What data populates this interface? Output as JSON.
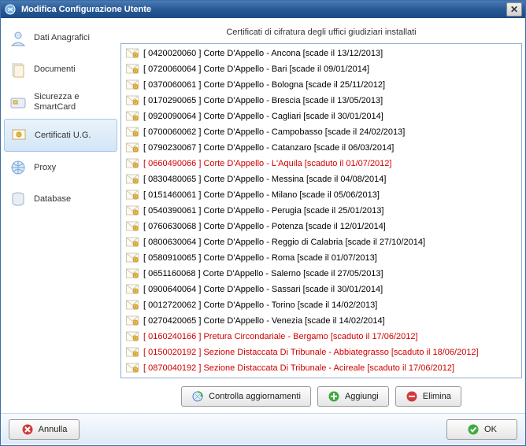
{
  "window": {
    "title": "Modifica Configurazione Utente"
  },
  "sidebar": {
    "items": [
      {
        "label": "Dati Anagrafici"
      },
      {
        "label": "Documenti"
      },
      {
        "label": "Sicurezza e SmartCard"
      },
      {
        "label": "Certificati U.G."
      },
      {
        "label": "Proxy"
      },
      {
        "label": "Database"
      }
    ],
    "selected_index": 3
  },
  "panel": {
    "header": "Certificati di cifratura degli uffici giudiziari installati"
  },
  "certificates": [
    {
      "text": "[ 0420020060 ] Corte D'Appello - Ancona [scade il 13/12/2013]",
      "expired": false
    },
    {
      "text": "[ 0720060064 ] Corte D'Appello - Bari [scade il 09/01/2014]",
      "expired": false
    },
    {
      "text": "[ 0370060061 ] Corte D'Appello - Bologna [scade il 25/11/2012]",
      "expired": false
    },
    {
      "text": "[ 0170290065 ] Corte D'Appello - Brescia [scade il 13/05/2013]",
      "expired": false
    },
    {
      "text": "[ 0920090064 ] Corte D'Appello - Cagliari [scade il 30/01/2014]",
      "expired": false
    },
    {
      "text": "[ 0700060062 ] Corte D'Appello - Campobasso [scade il 24/02/2013]",
      "expired": false
    },
    {
      "text": "[ 0790230067 ] Corte D'Appello - Catanzaro [scade il 06/03/2014]",
      "expired": false
    },
    {
      "text": "[ 0660490066 ] Corte D'Appello - L'Aquila [scaduto il 01/07/2012]",
      "expired": true
    },
    {
      "text": "[ 0830480065 ] Corte D'Appello - Messina [scade il 04/08/2014]",
      "expired": false
    },
    {
      "text": "[ 0151460061 ] Corte D'Appello - Milano [scade il 05/06/2013]",
      "expired": false
    },
    {
      "text": "[ 0540390061 ] Corte D'Appello - Perugia [scade il 25/01/2013]",
      "expired": false
    },
    {
      "text": "[ 0760630068 ] Corte D'Appello - Potenza [scade il 12/01/2014]",
      "expired": false
    },
    {
      "text": "[ 0800630064 ] Corte D'Appello - Reggio di Calabria [scade il 27/10/2014]",
      "expired": false
    },
    {
      "text": "[ 0580910065 ] Corte D'Appello - Roma [scade il 01/07/2013]",
      "expired": false
    },
    {
      "text": "[ 0651160068 ] Corte D'Appello - Salerno [scade il 27/05/2013]",
      "expired": false
    },
    {
      "text": "[ 0900640064 ] Corte D'Appello - Sassari [scade il 30/01/2014]",
      "expired": false
    },
    {
      "text": "[ 0012720062 ] Corte D'Appello - Torino [scade il 14/02/2013]",
      "expired": false
    },
    {
      "text": "[ 0270420065 ] Corte D'Appello - Venezia [scade il 14/02/2014]",
      "expired": false
    },
    {
      "text": "[ 0160240166 ] Pretura Circondariale - Bergamo [scaduto il 17/06/2012]",
      "expired": true
    },
    {
      "text": "[ 0150020192 ] Sezione Distaccata Di Tribunale - Abbiategrasso [scaduto il 18/06/2012]",
      "expired": true
    },
    {
      "text": "[ 0870040192 ] Sezione Distaccata Di Tribunale - Acireale [scaduto il 17/06/2012]",
      "expired": true
    }
  ],
  "actions": {
    "update": "Controlla aggiornamenti",
    "add": "Aggiungi",
    "delete": "Elimina"
  },
  "bottom": {
    "cancel": "Annulla",
    "ok": "OK"
  }
}
